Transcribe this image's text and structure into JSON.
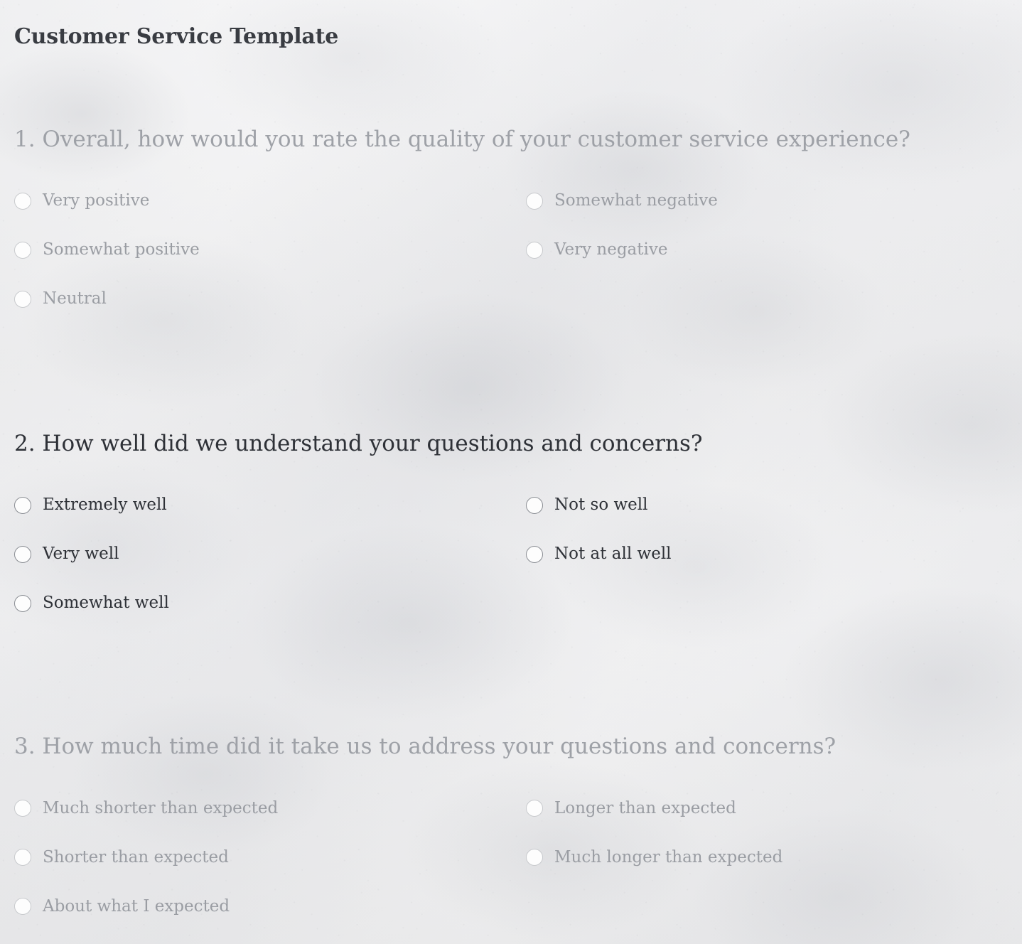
{
  "document": {
    "title": "Customer Service Template"
  },
  "questions": [
    {
      "number": "1.",
      "text": "1. Overall, how would you rate the quality of your customer service experience?",
      "state": "dim",
      "left_options": [
        {
          "label": "Very positive"
        },
        {
          "label": "Somewhat positive"
        },
        {
          "label": "Neutral"
        }
      ],
      "right_options": [
        {
          "label": "Somewhat negative"
        },
        {
          "label": "Very negative"
        }
      ]
    },
    {
      "number": "2.",
      "text": "2. How well did we understand your questions and concerns?",
      "state": "bright",
      "left_options": [
        {
          "label": "Extremely well"
        },
        {
          "label": "Very well"
        },
        {
          "label": "Somewhat well"
        }
      ],
      "right_options": [
        {
          "label": "Not so well"
        },
        {
          "label": "Not at all well"
        }
      ]
    },
    {
      "number": "3.",
      "text": "3. How much time did it take us to address your questions and concerns?",
      "state": "dim",
      "left_options": [
        {
          "label": "Much shorter than expected"
        },
        {
          "label": "Shorter than expected"
        },
        {
          "label": "About what I expected"
        }
      ],
      "right_options": [
        {
          "label": "Longer than expected"
        },
        {
          "label": "Much longer than expected"
        }
      ]
    }
  ],
  "colors": {
    "page_background": "#f1f1f2",
    "title_text": "#393c42",
    "active_text": "#2e3137",
    "dimmed_text": "#9a9da3",
    "active_radio_border": "#8a8d93",
    "dimmed_radio_border": "#c8cacd"
  }
}
